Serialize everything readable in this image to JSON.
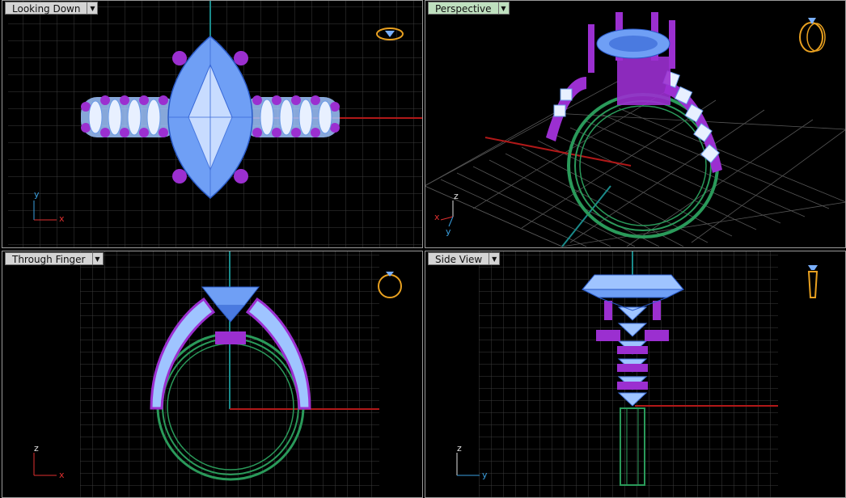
{
  "viewports": [
    {
      "title": "Looking Down",
      "active": false,
      "axes": {
        "horizontal": "x",
        "vertical": "y"
      }
    },
    {
      "title": "Perspective",
      "active": true,
      "axes": {
        "horizontal": "x",
        "vertical": "z",
        "depth": "y"
      }
    },
    {
      "title": "Through Finger",
      "active": false,
      "axes": {
        "horizontal": "x",
        "vertical": "z"
      }
    },
    {
      "title": "Side View",
      "active": false,
      "axes": {
        "horizontal": "y",
        "vertical": "z"
      }
    }
  ],
  "colors": {
    "grid": "#3a3a3a",
    "grid_major": "#4a4a4a",
    "x_axis": "#b01818",
    "y_axis": "#1a8a8a",
    "gem": "#7ab0ff",
    "gem_dark": "#3f6fd8",
    "prong": "#9b2fd0",
    "band": "#2a9a5a",
    "widget": "#e8a020",
    "axis_icon_x": "#e03030",
    "axis_icon_y": "#3aa0e0",
    "axis_icon_z": "#e0e0e0"
  },
  "icons": [
    "ring-view-icon",
    "dropdown-arrow-icon",
    "axis-gizmo-icon"
  ]
}
